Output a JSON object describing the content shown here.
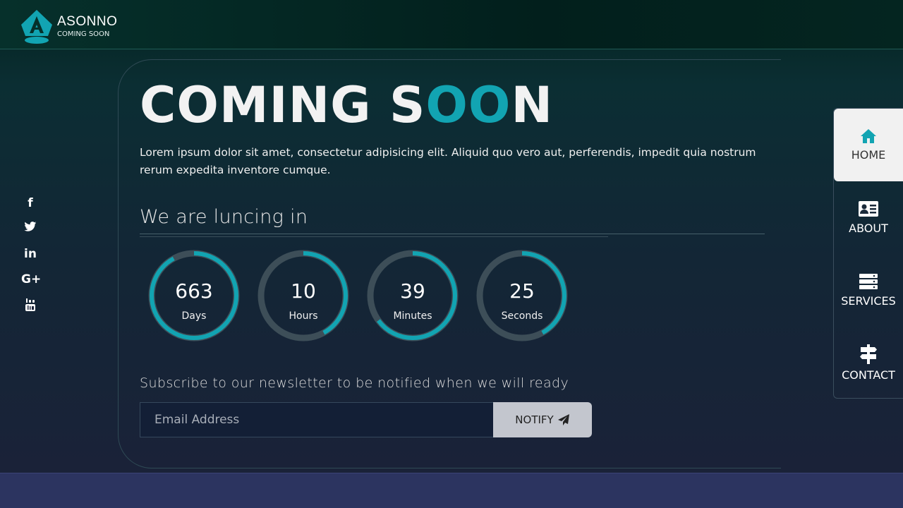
{
  "brand": {
    "name": "ASONNO",
    "tagline": "COMING SOON"
  },
  "hero": {
    "title_main": "COMING S",
    "title_accent": "OO",
    "title_end": "N",
    "description": "Lorem ipsum dolor sit amet, consectetur adipisicing elit. Aliquid quo vero aut, perferendis, impedit quia nostrum rerum expedita inventore cumque."
  },
  "launch_heading": "We are luncing in",
  "countdown": [
    {
      "value": "663",
      "unit": "Days",
      "progress": 0.92
    },
    {
      "value": "10",
      "unit": "Hours",
      "progress": 0.42
    },
    {
      "value": "39",
      "unit": "Minutes",
      "progress": 0.65
    },
    {
      "value": "25",
      "unit": "Seconds",
      "progress": 0.42
    }
  ],
  "newsletter": {
    "heading": "Subscribe to our newsletter to be notified when we will ready",
    "placeholder": "Email Address",
    "button_label": "NOTIFY"
  },
  "social": [
    {
      "name": "facebook-icon",
      "glyph": "f"
    },
    {
      "name": "twitter-icon",
      "glyph": ""
    },
    {
      "name": "linkedin-icon",
      "glyph": "in"
    },
    {
      "name": "google-plus-icon",
      "glyph": "G+"
    },
    {
      "name": "youtube-icon",
      "glyph": ""
    }
  ],
  "nav": [
    {
      "label": "HOME",
      "icon": "home-icon",
      "active": true
    },
    {
      "label": "ABOUT",
      "icon": "id-card-icon",
      "active": false
    },
    {
      "label": "SERVICES",
      "icon": "server-icon",
      "active": false
    },
    {
      "label": "CONTACT",
      "icon": "signpost-icon",
      "active": false
    }
  ],
  "colors": {
    "accent": "#12a4b2",
    "ring_track": "#3d4e58",
    "nav_active_bg": "#f1f1f1"
  }
}
